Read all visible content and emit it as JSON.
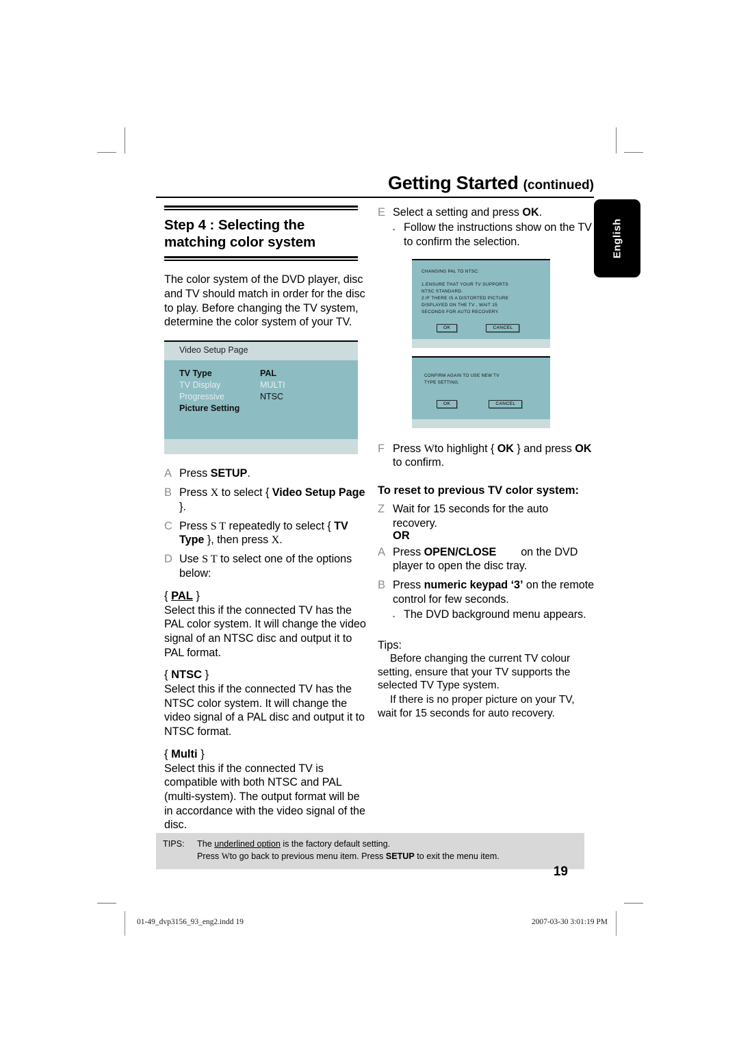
{
  "header": {
    "title": "Getting Started",
    "continued": "(continued)"
  },
  "side_tab": {
    "label": "English"
  },
  "left_column": {
    "step_title": "Step 4 : Selecting the matching color system",
    "intro": "The color system of the DVD player, disc and TV should match in order for the disc to play. Before changing the TV system, determine the color system of your TV.",
    "osd": {
      "header": "Video Setup Page",
      "rows": [
        {
          "label": "TV Type",
          "value": "PAL",
          "state": "on"
        },
        {
          "label": "TV Display",
          "value": "MULTI",
          "state": "dim"
        },
        {
          "label": "Progressive",
          "value": "NTSC",
          "state": "dim"
        },
        {
          "label": "Picture Setting",
          "value": "",
          "state": "on"
        }
      ]
    },
    "steps": [
      {
        "letter": "A",
        "text_parts": [
          {
            "t": "Press ",
            "b": false
          },
          {
            "t": "SETUP",
            "b": true
          },
          {
            "t": ".",
            "b": false
          }
        ]
      },
      {
        "letter": "B",
        "text_parts": [
          {
            "t": "Press ",
            "b": false
          },
          {
            "t": "X",
            "b": false,
            "sym": true
          },
          {
            "t": " to select { ",
            "b": false
          },
          {
            "t": "Video Setup Page",
            "b": true
          },
          {
            "t": " }.",
            "b": false
          }
        ]
      },
      {
        "letter": "C",
        "text_parts": [
          {
            "t": "Press ",
            "b": false
          },
          {
            "t": "S T",
            "b": false,
            "sym": true
          },
          {
            "t": " repeatedly to select { ",
            "b": false
          },
          {
            "t": "TV Type",
            "b": true
          },
          {
            "t": " }, then press ",
            "b": false
          },
          {
            "t": "X",
            "b": false,
            "sym": true
          },
          {
            "t": ".",
            "b": false
          }
        ]
      },
      {
        "letter": "D",
        "text_parts": [
          {
            "t": "Use ",
            "b": false
          },
          {
            "t": "S T",
            "b": false,
            "sym": true
          },
          {
            "t": " to select one of the options below:",
            "b": false
          }
        ]
      }
    ],
    "options": [
      {
        "name": "PAL",
        "underlined": true,
        "body": "Select this if the connected TV has the PAL color system. It will change the video signal of an NTSC disc and output it to PAL format."
      },
      {
        "name": "NTSC",
        "underlined": false,
        "body": "Select this if the connected TV has the NTSC color system. It will change the video signal of a PAL disc and output it to NTSC format."
      },
      {
        "name": "Multi",
        "underlined": false,
        "body": "Select this if the connected TV is compatible with both NTSC and PAL (multi-system). The output format will be in accordance with the video signal of the disc."
      }
    ]
  },
  "right_column": {
    "step_e": {
      "letter": "E",
      "lead": "Select a setting and press ",
      "bold": "OK",
      "tail": ".",
      "bullet": "Follow the instructions show on the TV to confirm the selection."
    },
    "dialog1": {
      "title": "CHANGING PAL TO NTSC:",
      "lines": [
        "1.ENSURE  THAT  YOUR  TV  SUPPORTS",
        "    NTSC STANDARD.",
        "2.IF  THERE  IS  A  DISTORTED  PICTURE",
        "    DISPLAYED  ON  THE  TV ,  WAIT  15",
        "    SECONDS   FOR   AUTO  RECOVERY."
      ],
      "ok": "OK",
      "cancel": "CANCEL"
    },
    "dialog2": {
      "lines": [
        "CONFIRM AGAIN TO USE NEW TV",
        "TYPE SETTING."
      ],
      "ok": "OK",
      "cancel": "CANCEL"
    },
    "step_f": {
      "letter": "F",
      "p1": "Press ",
      "sym": "W",
      "p2": "to highlight { ",
      "ok1": "OK",
      "p3": " } and press ",
      "ok2": "OK",
      "p4": " to confirm."
    },
    "reset_heading": "To reset to previous TV color system:",
    "step_z": {
      "letter": "Z",
      "text": "Wait for 15 seconds for the auto recovery."
    },
    "or": "OR",
    "step_a": {
      "letter": "A",
      "p1": "Press ",
      "bold": "OPEN/CLOSE",
      "p2": "on the DVD player to open the disc tray."
    },
    "step_b": {
      "letter": "B",
      "p1": "Press ",
      "bold": "numeric keypad ‘3’",
      "p2": " on the remote control for few seconds.",
      "bullet": "The DVD background menu appears."
    },
    "tips_heading": "Tips:",
    "tips": [
      "Before changing the current TV colour setting, ensure that your TV supports the selected TV Type  system.",
      "If there is no proper picture on your TV, wait for 15 seconds for auto recovery."
    ]
  },
  "tips_bar": {
    "label": "TIPS:",
    "line1_a": "The ",
    "line1_u": "underlined option",
    "line1_b": " is the factory default setting.",
    "line2_a": "Press ",
    "line2_sym": "W",
    "line2_b": "to go back to previous menu item. Press ",
    "line2_bold": "SETUP",
    "line2_c": " to exit the menu item."
  },
  "page_number": "19",
  "print_footer": {
    "file": "01-49_dvp3156_93_eng2.indd   19",
    "timestamp": "2007-03-30   3:01:19 PM"
  }
}
